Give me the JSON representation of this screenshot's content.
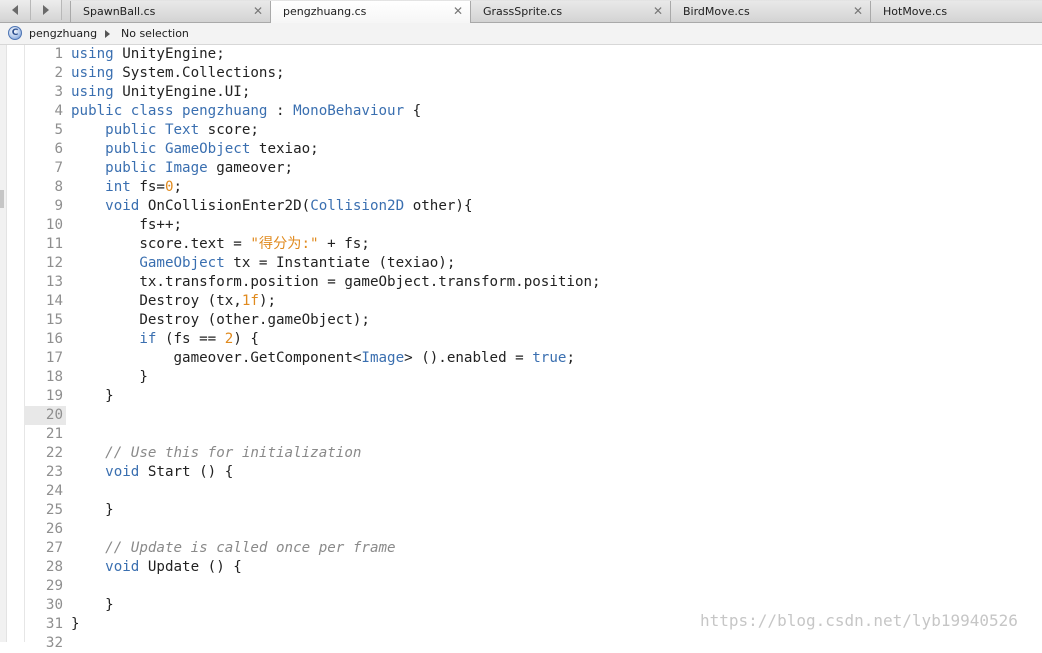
{
  "tabs": [
    {
      "label": "SpawnBall.cs",
      "active": false
    },
    {
      "label": "pengzhuang.cs",
      "active": true
    },
    {
      "label": "GrassSprite.cs",
      "active": false
    },
    {
      "label": "BirdMove.cs",
      "active": false
    },
    {
      "label": "HotMove.cs",
      "active": false
    }
  ],
  "tab_close_glyph": "✕",
  "breadcrumb": {
    "class_icon_letter": "C",
    "class_name": "pengzhuang",
    "member": "No selection"
  },
  "editor": {
    "current_line": 20,
    "lines": [
      {
        "n": "1",
        "tokens": [
          [
            "kw",
            "using"
          ],
          [
            "pl",
            " UnityEngine;"
          ]
        ]
      },
      {
        "n": "2",
        "tokens": [
          [
            "kw",
            "using"
          ],
          [
            "pl",
            " System.Collections;"
          ]
        ]
      },
      {
        "n": "3",
        "tokens": [
          [
            "kw",
            "using"
          ],
          [
            "pl",
            " UnityEngine.UI;"
          ]
        ]
      },
      {
        "n": "4",
        "tokens": [
          [
            "kw",
            "public class"
          ],
          [
            "pl",
            " "
          ],
          [
            "ty",
            "pengzhuang"
          ],
          [
            "pl",
            " : "
          ],
          [
            "ty",
            "MonoBehaviour"
          ],
          [
            "pl",
            " {"
          ]
        ]
      },
      {
        "n": "5",
        "tokens": [
          [
            "pl",
            "    "
          ],
          [
            "kw",
            "public"
          ],
          [
            "pl",
            " "
          ],
          [
            "ty",
            "Text"
          ],
          [
            "pl",
            " score;"
          ]
        ]
      },
      {
        "n": "6",
        "tokens": [
          [
            "pl",
            "    "
          ],
          [
            "kw",
            "public"
          ],
          [
            "pl",
            " "
          ],
          [
            "ty",
            "GameObject"
          ],
          [
            "pl",
            " texiao;"
          ]
        ]
      },
      {
        "n": "7",
        "tokens": [
          [
            "pl",
            "    "
          ],
          [
            "kw",
            "public"
          ],
          [
            "pl",
            " "
          ],
          [
            "ty",
            "Image"
          ],
          [
            "pl",
            " gameover;"
          ]
        ]
      },
      {
        "n": "8",
        "tokens": [
          [
            "pl",
            "    "
          ],
          [
            "kw",
            "int"
          ],
          [
            "pl",
            " fs="
          ],
          [
            "num",
            "0"
          ],
          [
            "pl",
            ";"
          ]
        ]
      },
      {
        "n": "9",
        "tokens": [
          [
            "pl",
            "    "
          ],
          [
            "kw",
            "void"
          ],
          [
            "pl",
            " OnCollisionEnter2D("
          ],
          [
            "ty",
            "Collision2D"
          ],
          [
            "pl",
            " other){"
          ]
        ]
      },
      {
        "n": "10",
        "tokens": [
          [
            "pl",
            "        fs++;"
          ]
        ]
      },
      {
        "n": "11",
        "tokens": [
          [
            "pl",
            "        score.text = "
          ],
          [
            "str",
            "\"得分为:\""
          ],
          [
            "pl",
            " + fs;"
          ]
        ]
      },
      {
        "n": "12",
        "tokens": [
          [
            "pl",
            "        "
          ],
          [
            "ty",
            "GameObject"
          ],
          [
            "pl",
            " tx = Instantiate (texiao);"
          ]
        ]
      },
      {
        "n": "13",
        "tokens": [
          [
            "pl",
            "        tx.transform.position = gameObject.transform.position;"
          ]
        ]
      },
      {
        "n": "14",
        "tokens": [
          [
            "pl",
            "        Destroy (tx,"
          ],
          [
            "num",
            "1f"
          ],
          [
            "pl",
            ");"
          ]
        ]
      },
      {
        "n": "15",
        "tokens": [
          [
            "pl",
            "        Destroy (other.gameObject);"
          ]
        ]
      },
      {
        "n": "16",
        "tokens": [
          [
            "pl",
            "        "
          ],
          [
            "kw",
            "if"
          ],
          [
            "pl",
            " (fs == "
          ],
          [
            "num",
            "2"
          ],
          [
            "pl",
            ") {"
          ]
        ]
      },
      {
        "n": "17",
        "tokens": [
          [
            "pl",
            "            gameover.GetComponent<"
          ],
          [
            "ty",
            "Image"
          ],
          [
            "pl",
            "> ().enabled = "
          ],
          [
            "kw",
            "true"
          ],
          [
            "pl",
            ";"
          ]
        ]
      },
      {
        "n": "18",
        "tokens": [
          [
            "pl",
            "        }"
          ]
        ]
      },
      {
        "n": "19",
        "tokens": [
          [
            "pl",
            "    }"
          ]
        ]
      },
      {
        "n": "20",
        "tokens": []
      },
      {
        "n": "21",
        "tokens": []
      },
      {
        "n": "22",
        "tokens": [
          [
            "pl",
            "    "
          ],
          [
            "com",
            "// Use this for initialization"
          ]
        ]
      },
      {
        "n": "23",
        "tokens": [
          [
            "pl",
            "    "
          ],
          [
            "kw",
            "void"
          ],
          [
            "pl",
            " Start () {"
          ]
        ]
      },
      {
        "n": "24",
        "tokens": []
      },
      {
        "n": "25",
        "tokens": [
          [
            "pl",
            "    }"
          ]
        ]
      },
      {
        "n": "26",
        "tokens": []
      },
      {
        "n": "27",
        "tokens": [
          [
            "pl",
            "    "
          ],
          [
            "com",
            "// Update is called once per frame"
          ]
        ]
      },
      {
        "n": "28",
        "tokens": [
          [
            "pl",
            "    "
          ],
          [
            "kw",
            "void"
          ],
          [
            "pl",
            " Update () {"
          ]
        ]
      },
      {
        "n": "29",
        "tokens": []
      },
      {
        "n": "30",
        "tokens": [
          [
            "pl",
            "    }"
          ]
        ]
      },
      {
        "n": "31",
        "tokens": [
          [
            "pl",
            "}"
          ]
        ]
      },
      {
        "n": "32",
        "tokens": []
      }
    ]
  },
  "watermark": "https://blog.csdn.net/lyb19940526",
  "colors": {
    "keyword": "#3a6fb0",
    "number_string": "#e08a1e",
    "comment": "#8a8a8a"
  }
}
